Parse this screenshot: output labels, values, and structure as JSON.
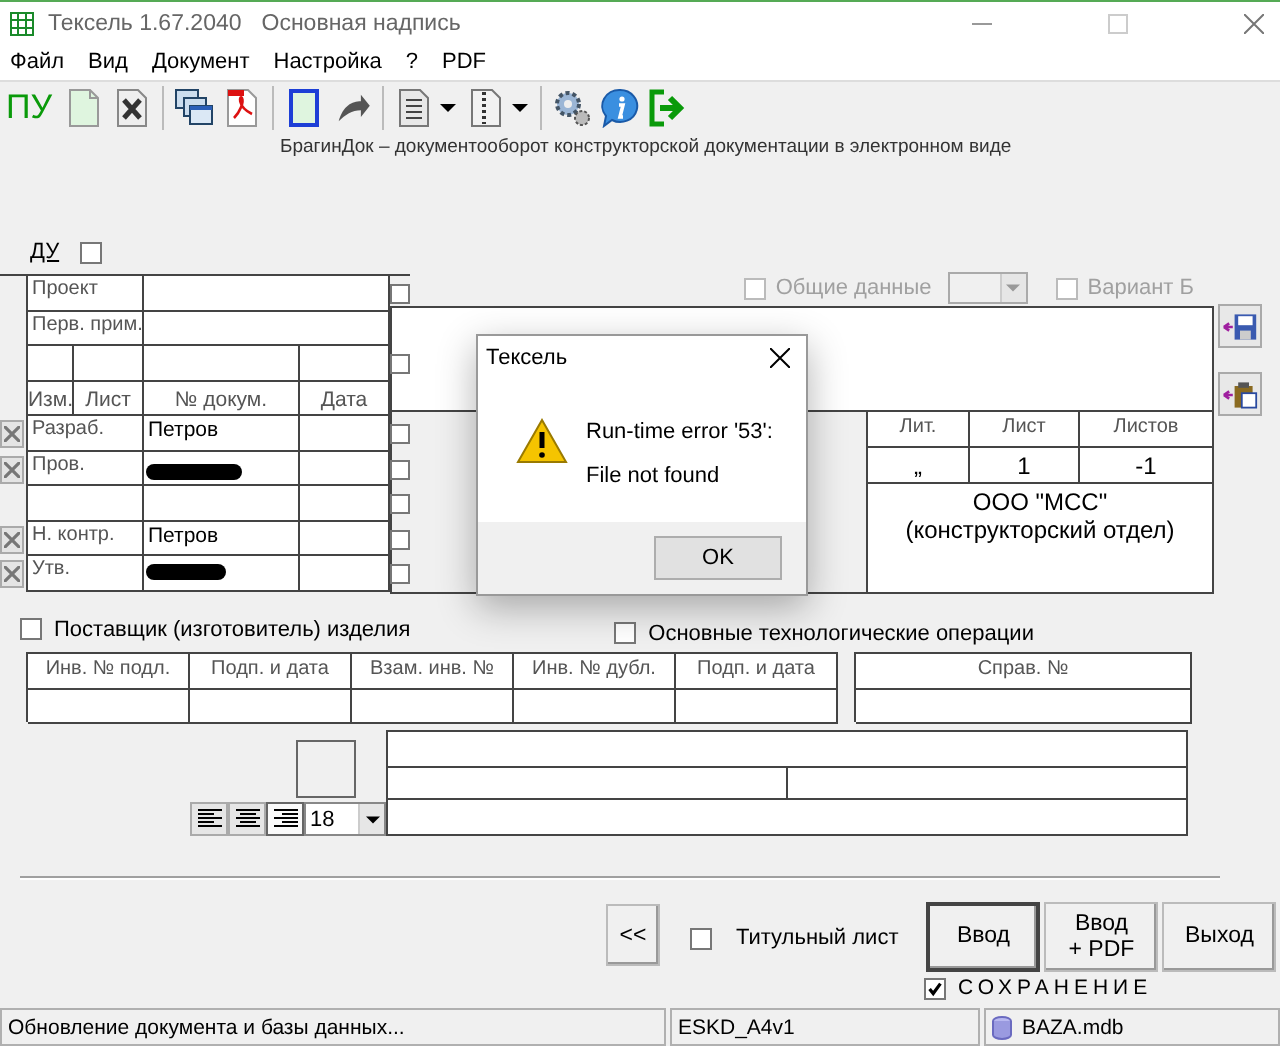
{
  "window": {
    "title": "Тексель 1.67.2040",
    "subtitle": "Основная надпись"
  },
  "menu": [
    "Файл",
    "Вид",
    "Документ",
    "Настройка",
    "?",
    "PDF"
  ],
  "toolbar": {
    "label": "ПУ",
    "caption": "БрагинДок – документооборот конструкторской документации в электронном виде"
  },
  "du": {
    "label": "ДУ",
    "checked": false
  },
  "options": [
    {
      "kind": "checkbox",
      "label": "Общие данные",
      "checked": false,
      "disabled": true
    },
    {
      "kind": "dropdown",
      "disabled": true
    },
    {
      "kind": "checkbox",
      "label": "Вариант Б",
      "checked": false,
      "disabled": true
    }
  ],
  "project_rows": [
    {
      "label": "Проект",
      "checked": false
    },
    {
      "label": "Перв. прим."
    }
  ],
  "change_row": {
    "checked": false
  },
  "change_header": [
    "Изм.",
    "Лист",
    "№ докум.",
    "Дата"
  ],
  "signatures": [
    {
      "role": "Разраб.",
      "name": "Петров",
      "removable": true,
      "checked": false
    },
    {
      "role": "Пров.",
      "redacted": true,
      "removable": true,
      "checked": false
    },
    {
      "removable": false,
      "checked": false
    },
    {
      "role": "Н. контр.",
      "name": "Петров",
      "removable": true,
      "checked": false
    },
    {
      "role": "Утв.",
      "redacted": true,
      "removable": true,
      "checked": false
    }
  ],
  "title_block": {
    "header": [
      "Лит.",
      "Лист",
      "Листов"
    ],
    "values": [
      "„",
      "1",
      "-1"
    ],
    "organization": [
      "ООО \"МСС\"",
      "(конструкторский отдел)"
    ]
  },
  "dialog": {
    "title": "Тексель",
    "message": "Run-time error '53':",
    "detail": "File not found",
    "button": "OK"
  },
  "supplier": {
    "label": "Поставщик (изготовитель) изделия",
    "checked": false
  },
  "tech_ops": {
    "label": "Основные технологические операции",
    "checked": false
  },
  "archive_columns": [
    "Инв. № подл.",
    "Подп. и дата",
    "Взам. инв. №",
    "Инв. № дубл.",
    "Подп. и дата"
  ],
  "ref_column": "Справ. №",
  "alignment": [
    {
      "kind": "left",
      "selected": false
    },
    {
      "kind": "center",
      "selected": false
    },
    {
      "kind": "right",
      "selected": true
    }
  ],
  "font_size": "18",
  "nav_button": "<<",
  "title_sheet": {
    "label": "Титульный лист",
    "checked": false
  },
  "buttons": [
    {
      "lines": [
        "Ввод"
      ],
      "default": true
    },
    {
      "lines": [
        "Ввод",
        "+ PDF"
      ],
      "default": false
    },
    {
      "lines": [
        "Выход"
      ],
      "default": false
    }
  ],
  "save": {
    "label": "СОХРАНЕНИЕ",
    "checked": true
  },
  "status_bar": [
    {
      "text": "Обновление документа и базы данных...",
      "kind": "text"
    },
    {
      "text": "ESKD_A4v1",
      "kind": "text"
    },
    {
      "text": "BAZA.mdb",
      "kind": "database"
    }
  ]
}
